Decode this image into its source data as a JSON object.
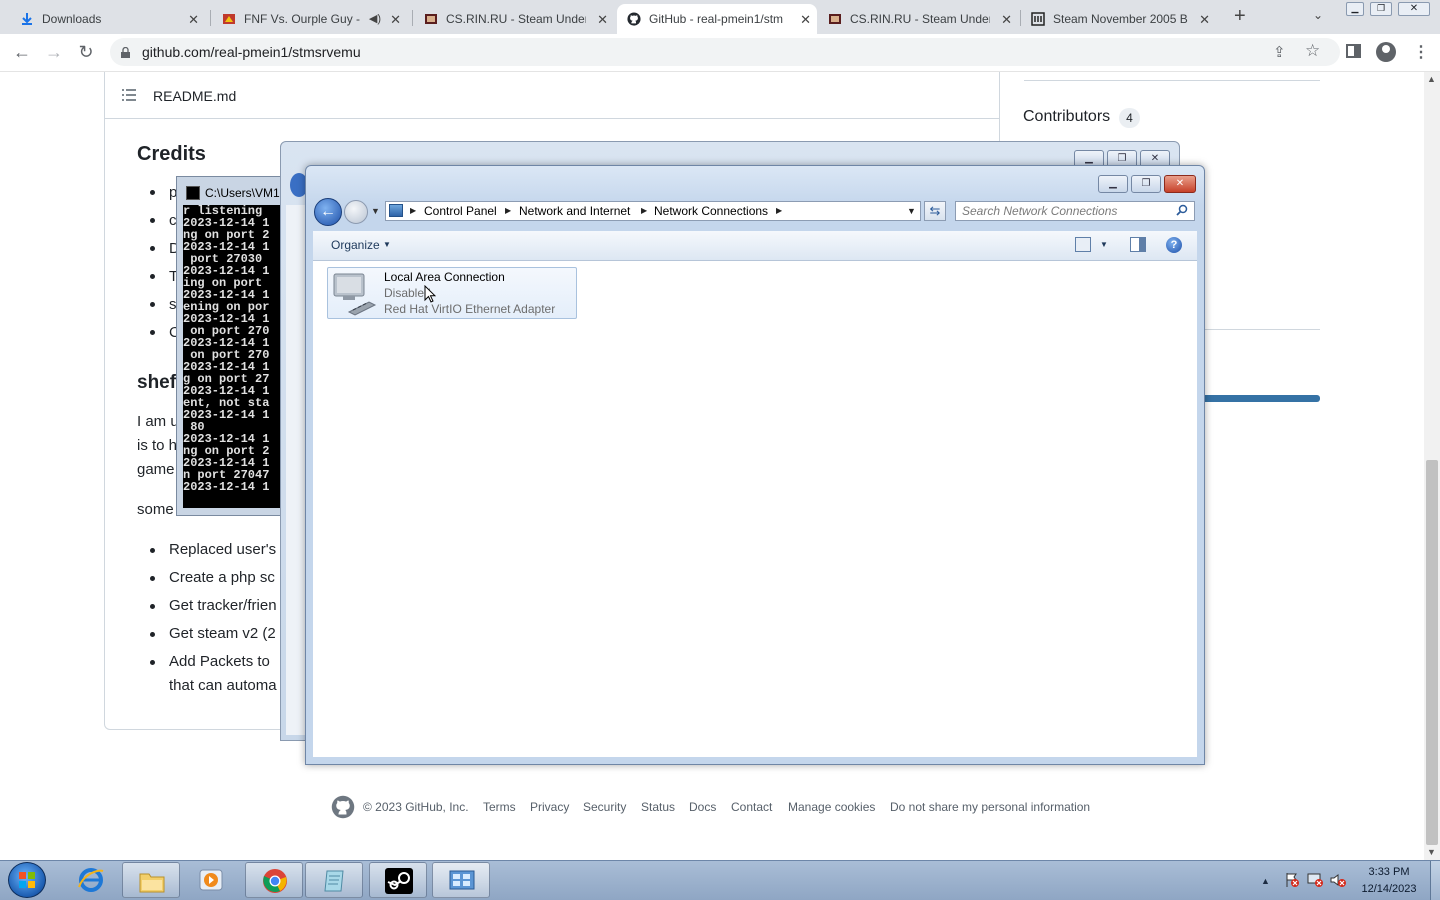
{
  "browser": {
    "tabs": [
      {
        "label": "Downloads",
        "icon": "download-icon"
      },
      {
        "label": "FNF Vs. Ourple Guy -",
        "icon": "gamebanana-icon"
      },
      {
        "label": "CS.RIN.RU - Steam Underg",
        "icon": "csrin-icon"
      },
      {
        "label": "GitHub - real-pmein1/stm",
        "icon": "github-icon"
      },
      {
        "label": "CS.RIN.RU - Steam Underg",
        "icon": "csrin-icon"
      },
      {
        "label": "Steam November 2005 Bu",
        "icon": "archive-icon"
      }
    ],
    "url": "github.com/real-pmein1/stmsrvemu"
  },
  "readme": {
    "file_name": "README.md",
    "credits_heading": "Credits",
    "credits_items_visible": [
      "p",
      "c",
      "D",
      "T",
      "s",
      "C"
    ],
    "section_heading_partial": "shef",
    "paragraph_lines": [
      "I am u",
      "is to h",
      "game"
    ],
    "some_line": "some",
    "list_items": [
      "Replaced user's",
      "Create a php sc",
      "Get tracker/frien",
      "Get steam v2 (2",
      "Add Packets to"
    ],
    "list_item_continuation": "that can automa"
  },
  "sidebar": {
    "contributors_label": "Contributors",
    "contributors_count": "4"
  },
  "footer": {
    "copyright": "© 2023 GitHub, Inc.",
    "links": [
      "Terms",
      "Privacy",
      "Security",
      "Status",
      "Docs",
      "Contact",
      "Manage cookies",
      "Do not share my personal information"
    ]
  },
  "console": {
    "title": "C:\\Users\\VM1",
    "lines": [
      "r listening",
      "2023-12-14 1",
      "ng on port 2",
      "2023-12-14 1",
      " port 27030",
      "2023-12-14 1",
      "ing on port",
      "2023-12-14 1",
      "ening on por",
      "2023-12-14 1",
      " on port 270",
      "2023-12-14 1",
      " on port 270",
      "2023-12-14 1",
      "g on port 27",
      "2023-12-14 1",
      "ent, not sta",
      "2023-12-14 1",
      " 80",
      "2023-12-14 1",
      "ng on port 2",
      "2023-12-14 1",
      "n port 27047",
      "2023-12-14 1"
    ]
  },
  "explorer": {
    "breadcrumb": [
      "Control Panel",
      "Network and Internet",
      "Network Connections"
    ],
    "search_placeholder": "Search Network Connections",
    "organize_label": "Organize",
    "connection": {
      "name": "Local Area Connection",
      "status": "Disabled",
      "adapter": "Red Hat VirtIO Ethernet Adapter"
    }
  },
  "taskbar": {
    "time": "3:33 PM",
    "date": "12/14/2023",
    "apps": [
      "start-orb-icon",
      "internet-explorer-icon",
      "file-explorer-icon",
      "media-player-icon",
      "chrome-icon",
      "notepad-icon",
      "steam-icon",
      "network-connections-icon"
    ]
  }
}
